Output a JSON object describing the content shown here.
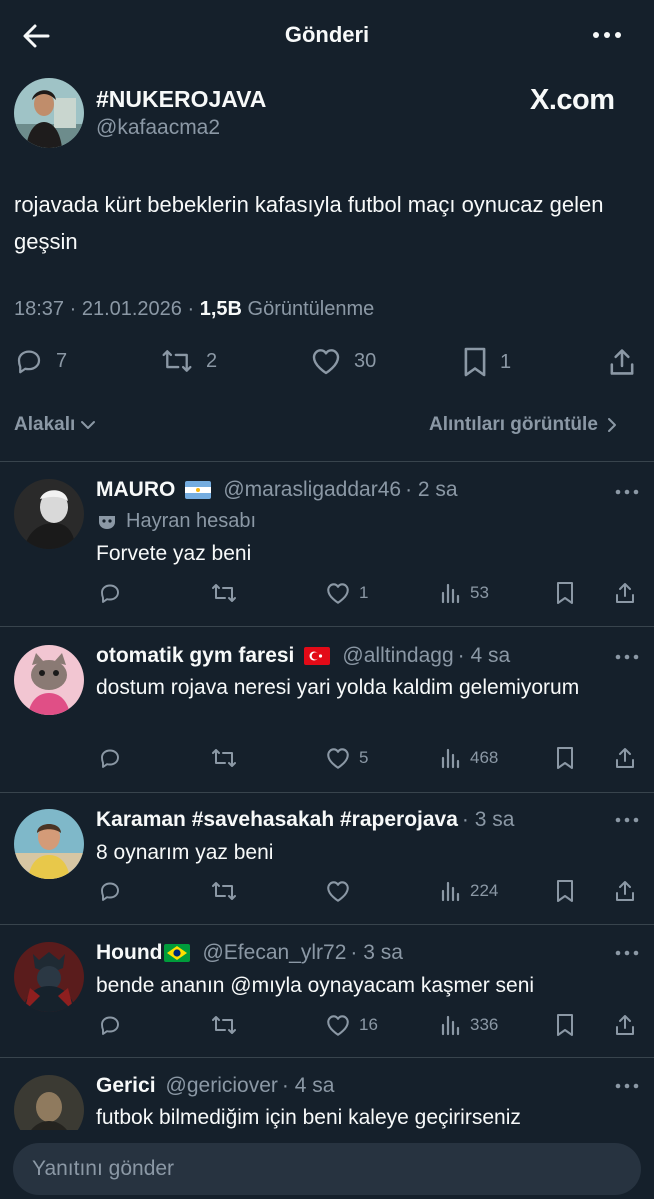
{
  "header": {
    "title": "Gönderi"
  },
  "tweet": {
    "name": "#NUKEROJAVA",
    "handle": "@kafaacma2",
    "brand": "X.com",
    "text": "rojavada kürt bebeklerin kafasıyla futbol maçı oynucaz gelen geşsin",
    "time": "18:37 · 21.01.2026 · ",
    "views": "1,5B",
    "views_label": " Görüntülenme",
    "replies": "7",
    "retweets": "2",
    "likes": "30",
    "bookmarks": "1"
  },
  "filters": {
    "sort_label": "Alakalı",
    "quotes_label": "Alıntıları görüntüle"
  },
  "replies": [
    {
      "name": "MAURO",
      "flag": "argentina-flag",
      "handle": "@marasligaddar46",
      "time": "· 2 sa",
      "badge": "Hayran hesabı",
      "text": "Forvete yaz beni",
      "likes": "1",
      "views": "53"
    },
    {
      "name": "otomatik gym faresi",
      "flag": "turkey-flag",
      "handle": "@alltindagg",
      "time": "· 4 sa",
      "text": "dostum rojava neresi yari yolda kaldim gelemiyorum",
      "likes": "5",
      "views": "468"
    },
    {
      "name": "Karaman #savehasakah #raperojava",
      "handle": "",
      "time": "· 3 sa",
      "text": "8 oynarım yaz beni",
      "likes": "",
      "views": "224"
    },
    {
      "name": "Hound",
      "flag": "brazil-flag",
      "handle": "@Efecan_ylr72",
      "time": "· 3 sa",
      "text": "bende ananın @mıyla oynayacam kaşmer seni",
      "likes": "16",
      "views": "336"
    },
    {
      "name": "Gerici",
      "handle": "@gericiover",
      "time": "· 4 sa",
      "text": "futbok bilmediğim için beni kaleye geçirirseniz"
    }
  ],
  "compose": {
    "placeholder": "Yanıtını gönder"
  },
  "colors": {
    "background": "#15202b",
    "text": "#f7f9f9",
    "muted": "#8b98a5",
    "divider": "#38444d",
    "input": "#273340"
  }
}
